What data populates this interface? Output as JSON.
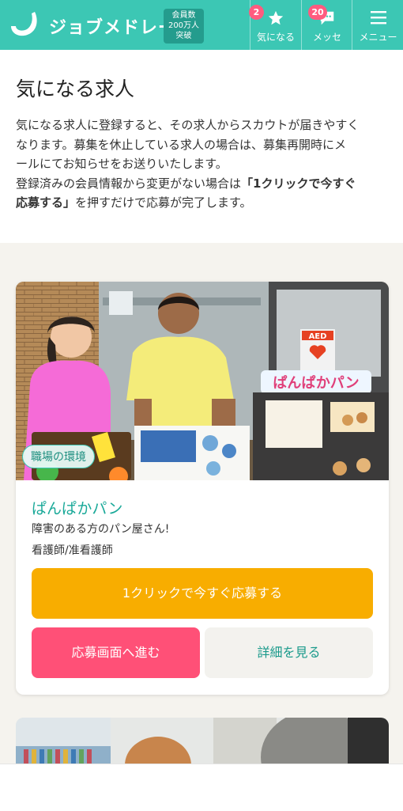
{
  "header": {
    "brand": "ジョブメドレー",
    "members_badge": [
      "会員数",
      "200万人",
      "突破"
    ],
    "nav": [
      {
        "label": "気になる",
        "badge": "2",
        "icon": "star-icon"
      },
      {
        "label": "メッセ",
        "badge": "20",
        "icon": "chat-icon"
      },
      {
        "label": "メニュー",
        "icon": "hamburger-menu-icon"
      }
    ],
    "colors": {
      "brand": "#3cc7b4",
      "badge": "#ff5b7f"
    }
  },
  "intro": {
    "title": "気になる求人",
    "paragraph_lines": [
      "気になる求人に登録すると、その求人からスカウトが届きやすく",
      "なります。募集を休止している求人の場合は、募集再開時にメ",
      "ールにてお知らせをお送りいたします。"
    ],
    "note_line1_before": "登録済みの会員情報から変更がない場合は",
    "note_bold": "「1クリックで今すぐ",
    "note_line2_bold": "応募する」",
    "note_line2_after": "を押すだけで応募が完了します。"
  },
  "jobs": [
    {
      "photo_tag": "職場の環境",
      "company": "ぱんぱかパン",
      "catch": "障害のある方のパン屋さん!",
      "job_type": "看護師/准看護師",
      "buttons": {
        "one_click": "1クリックで今すぐ応募する",
        "apply": "応募画面へ進む",
        "detail": "詳細を見る"
      },
      "photo_sign_text": "ぱんぱかパン",
      "photo_aed_text": "AED",
      "colors": {
        "one_click": "#f8ad00",
        "apply": "#ff5077",
        "company": "#1aa999"
      }
    }
  ]
}
